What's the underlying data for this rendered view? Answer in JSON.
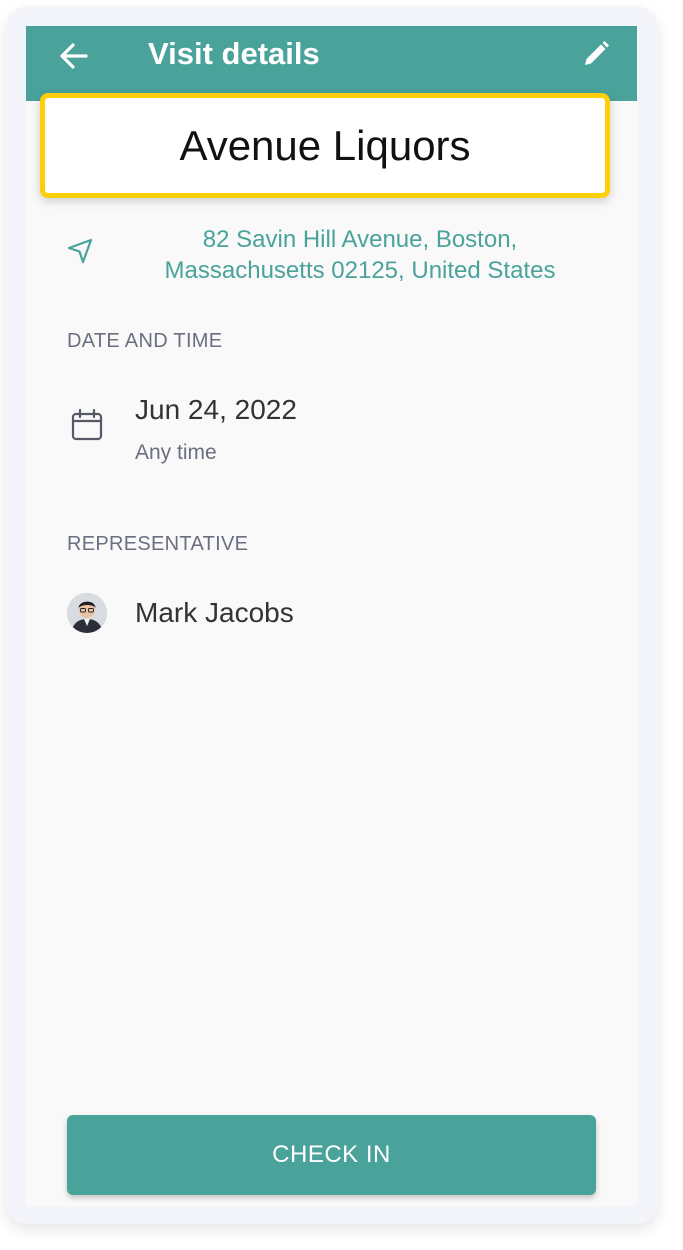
{
  "header": {
    "title": "Visit details",
    "back_icon": "arrow-left-icon",
    "edit_icon": "pencil-icon"
  },
  "store": {
    "name": "Avenue Liquors",
    "address_line1": "82 Savin Hill Avenue, Boston,",
    "address_line2": "Massachusetts 02125, United States",
    "address_icon": "navigation-arrow-icon"
  },
  "date_section": {
    "label": "DATE AND TIME",
    "date": "Jun 24, 2022",
    "time": "Any time",
    "icon": "calendar-icon"
  },
  "rep_section": {
    "label": "REPRESENTATIVE",
    "name": "Mark Jacobs"
  },
  "actions": {
    "check_in": "CHECK IN"
  },
  "colors": {
    "accent": "#4aa39b",
    "highlight_border": "#fdce0a",
    "background": "#f9f9f9",
    "frame": "#f4f5fa"
  }
}
